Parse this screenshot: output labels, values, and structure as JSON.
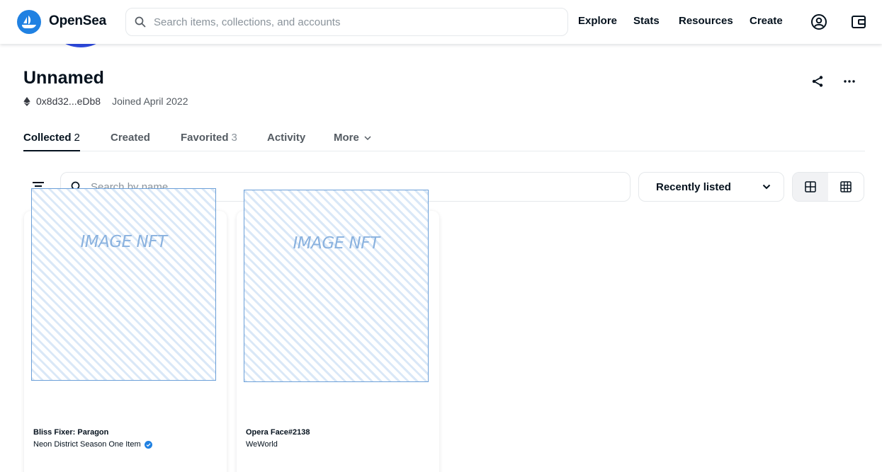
{
  "header": {
    "brand": "OpenSea",
    "search_placeholder": "Search items, collections, and accounts",
    "nav": [
      "Explore",
      "Stats",
      "Resources",
      "Create"
    ],
    "icons": [
      "account-icon",
      "wallet-icon"
    ],
    "brand_color": "#2081e2"
  },
  "profile": {
    "name": "Unnamed",
    "address": "0x8d32...eDb8",
    "joined": "Joined April 2022",
    "actions": [
      "share-icon",
      "more-icon"
    ]
  },
  "tabs": [
    {
      "label": "Collected",
      "count": "2",
      "active": true
    },
    {
      "label": "Created",
      "count": ""
    },
    {
      "label": "Favorited",
      "count": "3"
    },
    {
      "label": "Activity",
      "count": ""
    },
    {
      "label": "More",
      "count": ""
    }
  ],
  "filters": {
    "search_placeholder": "Search by name",
    "sort_selected": "Recently listed"
  },
  "items": [
    {
      "image_label": "IMAGE NFT",
      "title": "Bliss Fixer: Paragon",
      "collection": "Neon District Season One Item",
      "verified": true
    },
    {
      "image_label": "IMAGE NFT",
      "title": "Opera Face#2138",
      "collection": "WeWorld",
      "verified": false
    }
  ]
}
